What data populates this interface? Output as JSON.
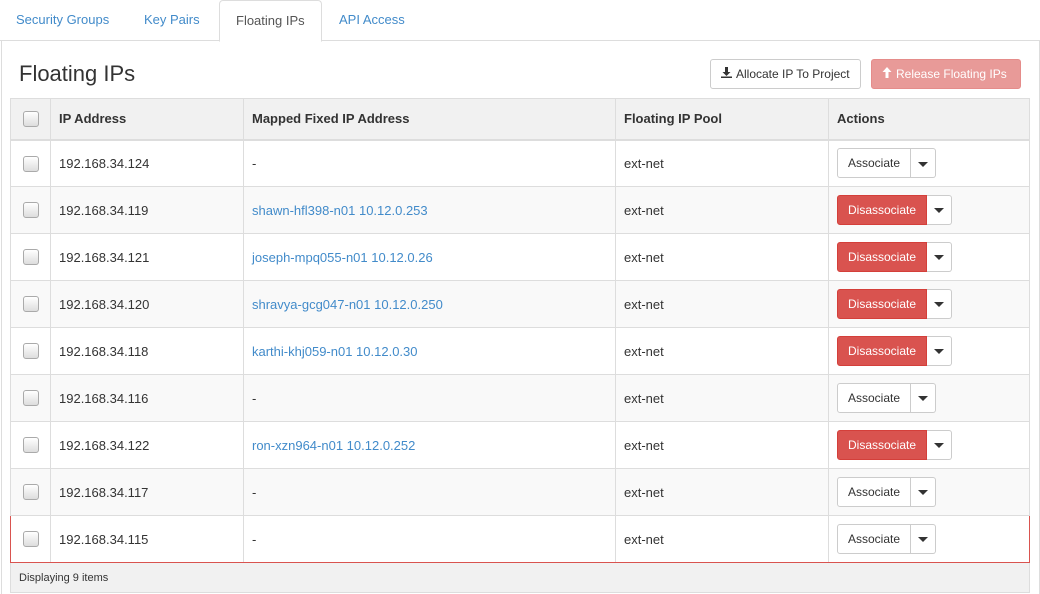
{
  "tabs": [
    {
      "label": "Security Groups",
      "active": false
    },
    {
      "label": "Key Pairs",
      "active": false
    },
    {
      "label": "Floating IPs",
      "active": true
    },
    {
      "label": "API Access",
      "active": false
    }
  ],
  "page": {
    "title": "Floating IPs",
    "allocate_label": "Allocate IP To Project",
    "release_label": "Release Floating IPs"
  },
  "table": {
    "headers": [
      "IP Address",
      "Mapped Fixed IP Address",
      "Floating IP Pool",
      "Actions"
    ],
    "rows": [
      {
        "ip": "192.168.34.124",
        "mapped": "-",
        "pool": "ext-net",
        "action": "Associate"
      },
      {
        "ip": "192.168.34.119",
        "mapped": "shawn-hfl398-n01 10.12.0.253",
        "pool": "ext-net",
        "action": "Disassociate"
      },
      {
        "ip": "192.168.34.121",
        "mapped": "joseph-mpq055-n01 10.12.0.26",
        "pool": "ext-net",
        "action": "Disassociate"
      },
      {
        "ip": "192.168.34.120",
        "mapped": "shravya-gcg047-n01 10.12.0.250",
        "pool": "ext-net",
        "action": "Disassociate"
      },
      {
        "ip": "192.168.34.118",
        "mapped": "karthi-khj059-n01 10.12.0.30",
        "pool": "ext-net",
        "action": "Disassociate"
      },
      {
        "ip": "192.168.34.116",
        "mapped": "-",
        "pool": "ext-net",
        "action": "Associate"
      },
      {
        "ip": "192.168.34.122",
        "mapped": "ron-xzn964-n01 10.12.0.252",
        "pool": "ext-net",
        "action": "Disassociate"
      },
      {
        "ip": "192.168.34.117",
        "mapped": "-",
        "pool": "ext-net",
        "action": "Associate"
      },
      {
        "ip": "192.168.34.115",
        "mapped": "-",
        "pool": "ext-net",
        "action": "Associate"
      }
    ],
    "footer": "Displaying 9 items"
  },
  "colors": {
    "link": "#428bca",
    "danger": "#d9534f",
    "danger_disabled": "#e89a98"
  },
  "icons": {
    "allocate": "download-icon",
    "release": "arrow-up-icon",
    "dropdown": "caret-down-icon"
  }
}
